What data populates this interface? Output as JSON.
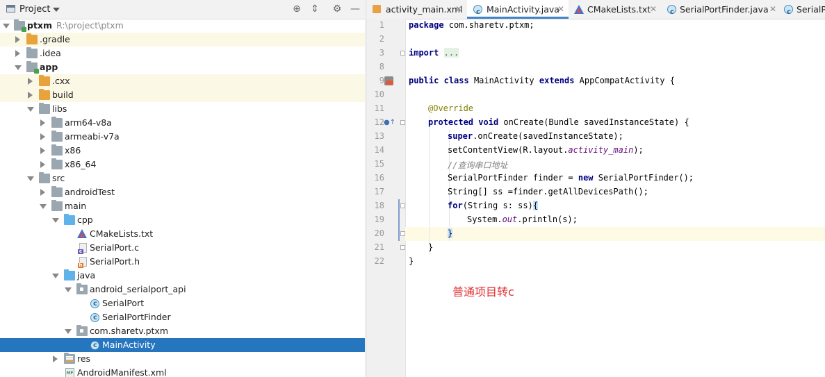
{
  "project_panel": {
    "title": "Project",
    "tree": [
      {
        "label": "ptxm",
        "path": "R:\\project\\ptxm"
      },
      {
        "label": ".gradle"
      },
      {
        "label": ".idea"
      },
      {
        "label": "app"
      },
      {
        "label": ".cxx"
      },
      {
        "label": "build"
      },
      {
        "label": "libs"
      },
      {
        "label": "arm64-v8a"
      },
      {
        "label": "armeabi-v7a"
      },
      {
        "label": "x86"
      },
      {
        "label": "x86_64"
      },
      {
        "label": "src"
      },
      {
        "label": "androidTest"
      },
      {
        "label": "main"
      },
      {
        "label": "cpp"
      },
      {
        "label": "CMakeLists.txt"
      },
      {
        "label": "SerialPort.c"
      },
      {
        "label": "SerialPort.h"
      },
      {
        "label": "java"
      },
      {
        "label": "android_serialport_api"
      },
      {
        "label": "SerialPort"
      },
      {
        "label": "SerialPortFinder"
      },
      {
        "label": "com.sharetv.ptxm"
      },
      {
        "label": "MainActivity"
      },
      {
        "label": "res"
      },
      {
        "label": "AndroidManifest.xml"
      }
    ]
  },
  "editor": {
    "tabs": [
      {
        "label": "activity_main.xml"
      },
      {
        "label": "MainActivity.java"
      },
      {
        "label": "CMakeLists.txt"
      },
      {
        "label": "SerialPortFinder.java"
      },
      {
        "label": "SerialPo"
      }
    ],
    "line_numbers": [
      "1",
      "2",
      "3",
      "8",
      "9",
      "10",
      "11",
      "12",
      "13",
      "14",
      "15",
      "16",
      "17",
      "18",
      "19",
      "20",
      "21",
      "22"
    ],
    "code": {
      "l1_kw": "package",
      "l1_rest": " com.sharetv.ptxm;",
      "l3_kw": "import",
      "l3_fold": "...",
      "l9_kw1": "public",
      "l9_kw2": "class",
      "l9_name": " MainActivity ",
      "l9_kw3": "extends",
      "l9_rest": " AppCompatActivity {",
      "l11_ann": "@Override",
      "l12_kw1": "protected",
      "l12_kw2": "void",
      "l12_rest": " onCreate(Bundle savedInstanceState) {",
      "l13_kw": "super",
      "l13_rest": ".onCreate(savedInstanceState);",
      "l14_a": "setContentView(R.layout.",
      "l14_it": "activity_main",
      "l14_b": ");",
      "l15_cm": "//查询串口地址",
      "l16_a": "SerialPortFinder finder = ",
      "l16_kw": "new",
      "l16_b": " SerialPortFinder();",
      "l17": "String[] ss =finder.getAllDevicesPath();",
      "l18_kw": "for",
      "l18_a": "(String s: ss)",
      "l18_brace": "{",
      "l19_a": "System.",
      "l19_it": "out",
      "l19_b": ".println(s);",
      "l20": "}",
      "l21": "}",
      "l22": "}"
    }
  },
  "annotation_text": "普通项目转c"
}
